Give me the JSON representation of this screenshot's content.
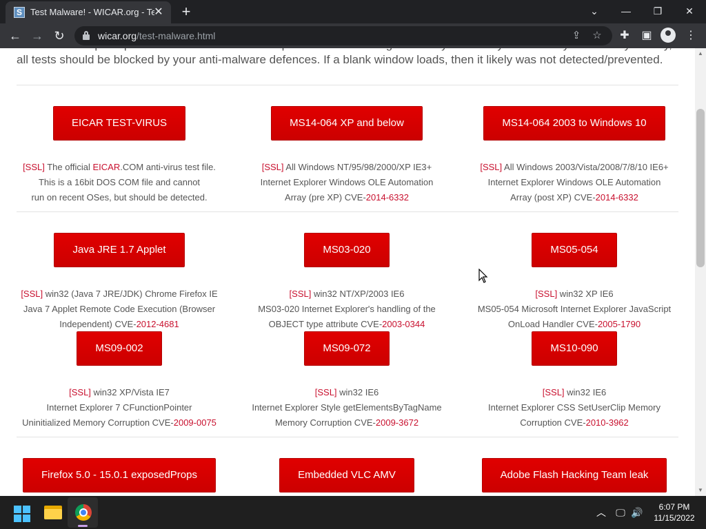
{
  "browser": {
    "tab_title": "Test Malware! - WICAR.org - Test",
    "tab_favicon_letter": "S",
    "tab_close_glyph": "✕",
    "new_tab_glyph": "+",
    "window_controls": {
      "chevron": "⌄",
      "minimize": "—",
      "restore": "❐",
      "close": "✕"
    },
    "url_domain": "wicar.org",
    "url_path": "/test-malware.html",
    "back_glyph": "←",
    "forward_glyph": "→",
    "reload_glyph": "↻",
    "share_glyph": "⇪",
    "bookmark_glyph": "☆",
    "extensions_glyph": "✚",
    "sidepanel_glyph": "▣",
    "menu_glyph": "⋮"
  },
  "page": {
    "intro": "Each test will open up a new browser window at http://malware.wicar.org/. You may wish to try each test systematically. Ideally, all tests should be blocked by your anti-malware defences. If a blank window loads, then it likely was not detected/prevented.",
    "tests": [
      {
        "button": "EICAR TEST-VIRUS",
        "ssl": "[SSL]",
        "l1a": " The official ",
        "l1link": "EICAR",
        "l1b": ".COM anti-virus test file.",
        "l2": "This is a 16bit DOS COM file and cannot",
        "l3a": "run on recent OSes, but should be detected.",
        "cve": ""
      },
      {
        "button": "MS14-064 XP and below",
        "ssl": "[SSL]",
        "l1a": " All Windows NT/95/98/2000/XP IE3+",
        "l1link": "",
        "l1b": "",
        "l2": "Internet Explorer Windows OLE Automation",
        "l3a": "Array (pre  XP) CVE-",
        "cve": "2014-6332"
      },
      {
        "button": "MS14-064 2003 to Windows 10",
        "ssl": "[SSL]",
        "l1a": " All Windows 2003/Vista/2008/7/8/10 IE6+",
        "l1link": "",
        "l1b": "",
        "l2": "Internet Explorer Windows OLE Automation",
        "l3a": "Array (post XP) CVE-",
        "cve": "2014-6332"
      },
      {
        "button": "Java JRE 1.7 Applet",
        "ssl": "[SSL]",
        "l1a": " win32 (Java 7 JRE/JDK) Chrome Firefox IE",
        "l1link": "",
        "l1b": "",
        "l2": "Java 7 Applet Remote Code Execution (Browser",
        "l3a": "Independent) CVE-",
        "cve": "2012-4681"
      },
      {
        "button": "MS03-020",
        "ssl": "[SSL]",
        "l1a": " win32 NT/XP/2003 IE6",
        "l1link": "",
        "l1b": "",
        "l2": "MS03-020 Internet Explorer's handling of the",
        "l3a": "OBJECT type attribute CVE-",
        "cve": "2003-0344"
      },
      {
        "button": "MS05-054",
        "ssl": "[SSL]",
        "l1a": " win32 XP IE6",
        "l1link": "",
        "l1b": "",
        "l2": "MS05-054 Microsoft Internet Explorer JavaScript",
        "l3a": "OnLoad Handler CVE-",
        "cve": "2005-1790"
      },
      {
        "button": "MS09-002",
        "ssl": "[SSL]",
        "l1a": " win32 XP/Vista IE7",
        "l1link": "",
        "l1b": "",
        "l2": "Internet Explorer 7 CFunctionPointer",
        "l3a": "Uninitialized Memory Corruption CVE-",
        "cve": "2009-0075"
      },
      {
        "button": "MS09-072",
        "ssl": "[SSL]",
        "l1a": " win32 IE6",
        "l1link": "",
        "l1b": "",
        "l2": "Internet Explorer Style getElementsByTagName",
        "l3a": "Memory Corruption CVE-",
        "cve": "2009-3672"
      },
      {
        "button": "MS10-090",
        "ssl": "[SSL]",
        "l1a": " win32 IE6",
        "l1link": "",
        "l1b": "",
        "l2": "Internet Explorer CSS SetUserClip Memory",
        "l3a": "Corruption CVE-",
        "cve": "2010-3962"
      },
      {
        "button": "Firefox 5.0 - 15.0.1 exposedProps"
      },
      {
        "button": "Embedded VLC AMV"
      },
      {
        "button": "Adobe Flash Hacking Team leak"
      }
    ]
  },
  "taskbar": {
    "time": "6:07 PM",
    "date": "11/15/2022",
    "tray_chevron": "︿",
    "network_glyph": "🖵",
    "volume_glyph": "🔊"
  },
  "colors": {
    "accent_red": "#d40000",
    "link_red": "#c8102e"
  }
}
